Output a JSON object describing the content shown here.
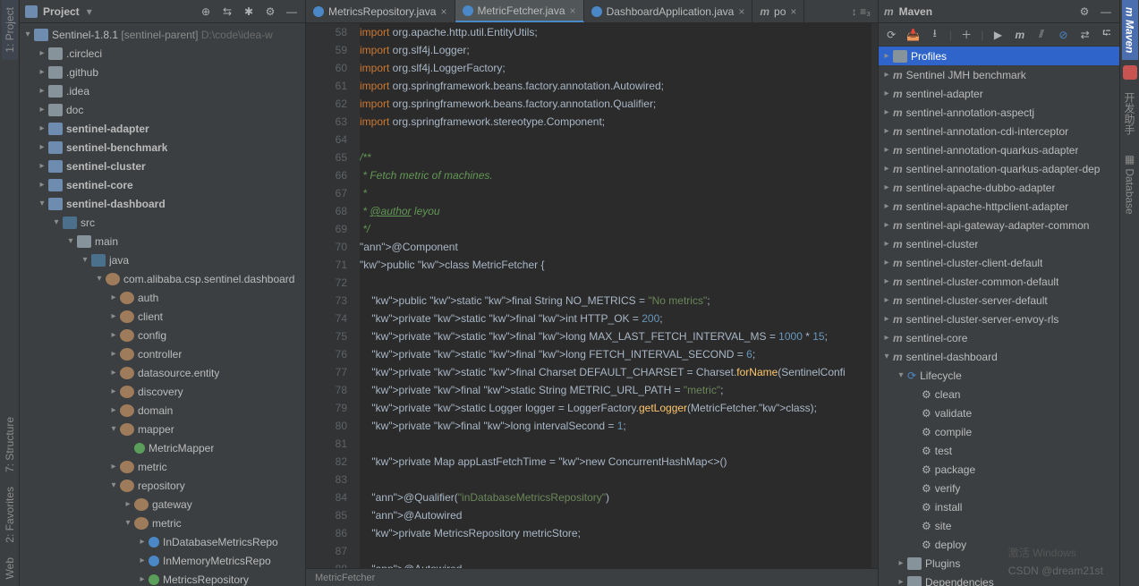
{
  "leftRail": {
    "project": "1: Project",
    "structure": "7: Structure",
    "favorites": "2: Favorites",
    "web": "Web"
  },
  "rightRail": {
    "maven": "Maven",
    "database": "Database",
    "helper": "开发助手"
  },
  "projectPanel": {
    "title": "Project",
    "root": {
      "name": "Sentinel-1.8.1",
      "qualifier": "[sentinel-parent]",
      "path": "D:\\code\\idea-w"
    },
    "folders": [
      ".circleci",
      ".github",
      ".idea",
      "doc"
    ],
    "modules": [
      "sentinel-adapter",
      "sentinel-benchmark",
      "sentinel-cluster",
      "sentinel-core",
      "sentinel-dashboard"
    ],
    "dashboard": {
      "src": "src",
      "main": "main",
      "java": "java",
      "pkg": "com.alibaba.csp.sentinel.dashboard",
      "subs": [
        "auth",
        "client",
        "config",
        "controller",
        "datasource.entity",
        "discovery",
        "domain"
      ],
      "mapper": "mapper",
      "mapperChild": "MetricMapper",
      "metric": "metric",
      "repository": "repository",
      "gateway": "gateway",
      "metricRepo": "metric",
      "repoItems": [
        "InDatabaseMetricsRepo",
        "InMemoryMetricsRepo",
        "MetricsRepository"
      ]
    }
  },
  "tabs": [
    {
      "label": "MetricsRepository.java"
    },
    {
      "label": "MetricFetcher.java",
      "active": true
    },
    {
      "label": "DashboardApplication.java"
    },
    {
      "label": "po",
      "icon": "m"
    }
  ],
  "editor": {
    "startLine": 58,
    "lines": [
      {
        "t": "import",
        "c": "import org.apache.http.util.EntityUtils;"
      },
      {
        "t": "import",
        "c": "import org.slf4j.Logger;"
      },
      {
        "t": "import",
        "c": "import org.slf4j.LoggerFactory;"
      },
      {
        "t": "import",
        "c": "import org.springframework.beans.factory.annotation.Autowired;"
      },
      {
        "t": "import",
        "c": "import org.springframework.beans.factory.annotation.Qualifier;"
      },
      {
        "t": "import",
        "c": "import org.springframework.stereotype.Component;"
      },
      {
        "t": "blank",
        "c": ""
      },
      {
        "t": "doc",
        "c": "/**"
      },
      {
        "t": "doc",
        "c": " * Fetch metric of machines."
      },
      {
        "t": "doc",
        "c": " *"
      },
      {
        "t": "doc",
        "c": " * @author leyou",
        "author": true
      },
      {
        "t": "doc",
        "c": " */"
      },
      {
        "t": "ann",
        "c": "@Component"
      },
      {
        "t": "decl",
        "c": "public class MetricFetcher {"
      },
      {
        "t": "blank",
        "c": ""
      },
      {
        "t": "field",
        "c": "    public static final String NO_METRICS = \"No metrics\";"
      },
      {
        "t": "field",
        "c": "    private static final int HTTP_OK = 200;"
      },
      {
        "t": "field",
        "c": "    private static final long MAX_LAST_FETCH_INTERVAL_MS = 1000 * 15;"
      },
      {
        "t": "field",
        "c": "    private static final long FETCH_INTERVAL_SECOND = 6;"
      },
      {
        "t": "field",
        "c": "    private static final Charset DEFAULT_CHARSET = Charset.forName(SentinelConfi"
      },
      {
        "t": "field",
        "c": "    private final static String METRIC_URL_PATH = \"metric\";"
      },
      {
        "t": "field",
        "c": "    private static Logger logger = LoggerFactory.getLogger(MetricFetcher.class);"
      },
      {
        "t": "field",
        "c": "    private final long intervalSecond = 1;"
      },
      {
        "t": "blank",
        "c": ""
      },
      {
        "t": "field",
        "c": "    private Map<String, AtomicLong> appLastFetchTime = new ConcurrentHashMap<>()"
      },
      {
        "t": "blank",
        "c": ""
      },
      {
        "t": "ann",
        "c": "    @Qualifier(\"inDatabaseMetricsRepository\")"
      },
      {
        "t": "ann",
        "c": "    @Autowired"
      },
      {
        "t": "field",
        "c": "    private MetricsRepository<MetricEntity> metricStore;"
      },
      {
        "t": "blank",
        "c": ""
      },
      {
        "t": "ann",
        "c": "    @Autowired"
      }
    ],
    "crumb": "MetricFetcher"
  },
  "mavenPanel": {
    "title": "Maven",
    "profiles": "Profiles",
    "modules": [
      "Sentinel JMH benchmark",
      "sentinel-adapter",
      "sentinel-annotation-aspectj",
      "sentinel-annotation-cdi-interceptor",
      "sentinel-annotation-quarkus-adapter",
      "sentinel-annotation-quarkus-adapter-dep",
      "sentinel-apache-dubbo-adapter",
      "sentinel-apache-httpclient-adapter",
      "sentinel-api-gateway-adapter-common",
      "sentinel-cluster",
      "sentinel-cluster-client-default",
      "sentinel-cluster-common-default",
      "sentinel-cluster-server-default",
      "sentinel-cluster-server-envoy-rls",
      "sentinel-core",
      "sentinel-dashboard"
    ],
    "lifecycle": {
      "label": "Lifecycle",
      "items": [
        "clean",
        "validate",
        "compile",
        "test",
        "package",
        "verify",
        "install",
        "site",
        "deploy"
      ]
    },
    "plugins": "Plugins",
    "deps": "Dependencies"
  },
  "watermark": {
    "line1": "激活 Windows",
    "line2": "CSDN @dream21st"
  }
}
